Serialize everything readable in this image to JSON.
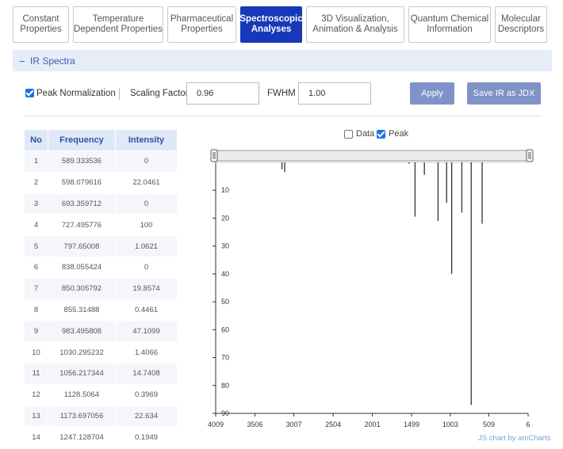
{
  "tabs": [
    {
      "label": "Constant\nProperties",
      "active": false
    },
    {
      "label": "Temperature\nDependent Properties",
      "active": false
    },
    {
      "label": "Pharmaceutical\nProperties",
      "active": false
    },
    {
      "label": "Spectroscopic\nAnalyses",
      "active": true
    },
    {
      "label": "3D Visualization,\nAnimation & Analysis",
      "active": false
    },
    {
      "label": "Quantum Chemical\nInformation",
      "active": false
    },
    {
      "label": "Molecular\nDescriptors",
      "active": false
    }
  ],
  "section": {
    "collapse_symbol": "−",
    "title": "IR Spectra"
  },
  "controls": {
    "peak_normalization_label": "Peak Normalization",
    "peak_normalization_checked": true,
    "scaling_factor_label": "Scaling Factor",
    "scaling_factor_value": "0.96",
    "fwhm_label": "FWHM",
    "fwhm_value": "1.00",
    "apply_label": "Apply",
    "save_label": "Save IR as JDX"
  },
  "table": {
    "headers": [
      "No",
      "Frequency",
      "Intensity"
    ],
    "rows": [
      [
        "1",
        "589.333536",
        "0"
      ],
      [
        "2",
        "598.079616",
        "22.0461"
      ],
      [
        "3",
        "693.359712",
        "0"
      ],
      [
        "4",
        "727.495776",
        "100"
      ],
      [
        "5",
        "797.65008",
        "1.0621"
      ],
      [
        "6",
        "838.055424",
        "0"
      ],
      [
        "7",
        "850.305792",
        "19.8574"
      ],
      [
        "8",
        "855.31488",
        "0.4461"
      ],
      [
        "9",
        "983.495808",
        "47.1099"
      ],
      [
        "10",
        "1030.295232",
        "1.4066"
      ],
      [
        "11",
        "1056.217344",
        "14.7408"
      ],
      [
        "12",
        "1128.5064",
        "0.3969"
      ],
      [
        "13",
        "1173.697056",
        "22.634"
      ],
      [
        "14",
        "1247.128704",
        "0.1949"
      ]
    ]
  },
  "legend": {
    "data_label": "Data",
    "data_checked": false,
    "peak_label": "Peak",
    "peak_checked": true
  },
  "chart_data": {
    "type": "line",
    "x_ticks": [
      "4009",
      "3506",
      "3007",
      "2504",
      "2001",
      "1499",
      "1003",
      "509",
      "6"
    ],
    "xlim": [
      4009,
      6
    ],
    "y_ticks": [
      "10",
      "20",
      "30",
      "40",
      "50",
      "60",
      "70",
      "80",
      "90"
    ],
    "ylim": [
      0,
      90
    ],
    "y_inverted": true,
    "peaks": [
      {
        "x": 3160,
        "y": 2.5
      },
      {
        "x": 3125,
        "y": 3.5
      },
      {
        "x": 1530,
        "y": 0.5
      },
      {
        "x": 1455,
        "y": 19.5
      },
      {
        "x": 1335,
        "y": 4.5
      },
      {
        "x": 1160,
        "y": 21
      },
      {
        "x": 1050,
        "y": 14.5
      },
      {
        "x": 985,
        "y": 40
      },
      {
        "x": 855,
        "y": 18
      },
      {
        "x": 735,
        "y": 87
      },
      {
        "x": 595,
        "y": 22
      }
    ],
    "credit": "JS chart by amCharts"
  },
  "colors": {
    "accent": "#1539b8",
    "button": "#7f93c7",
    "section_bg": "#e6edf9",
    "header_text": "#2a54a8"
  }
}
